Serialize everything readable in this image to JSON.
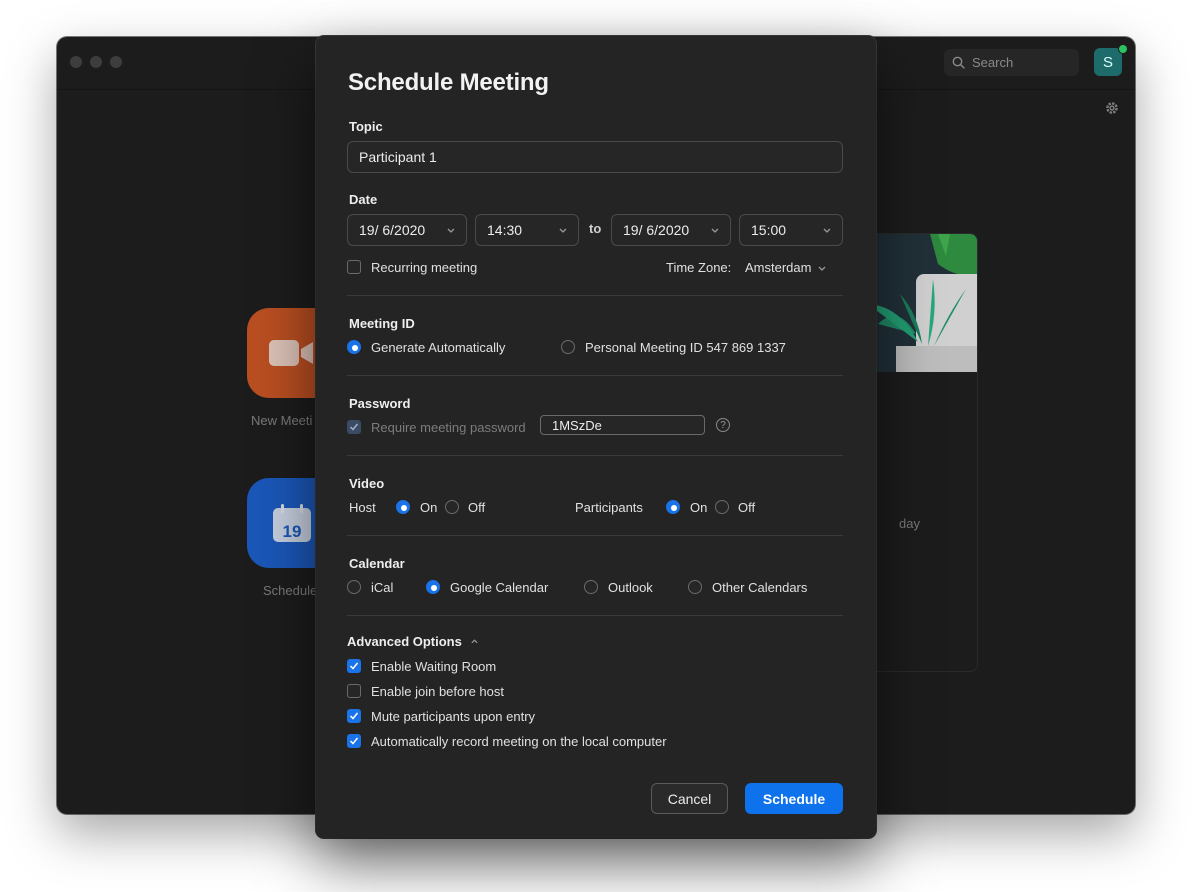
{
  "background": {
    "search_placeholder": "Search",
    "avatar_initial": "S",
    "tile_new_meeting_label": "New Meeti",
    "tile_schedule_label": "Schedule",
    "calendar_tile_day": "19",
    "card_text_fragment": "day"
  },
  "dialog": {
    "title": "Schedule Meeting",
    "topic": {
      "label": "Topic",
      "value": "Participant 1"
    },
    "date": {
      "label": "Date",
      "start_date": "19/ 6/2020",
      "start_time": "14:30",
      "to_label": "to",
      "end_date": "19/ 6/2020",
      "end_time": "15:00",
      "recurring_label": "Recurring meeting",
      "recurring_checked": false,
      "timezone_label": "Time Zone:",
      "timezone_value": "Amsterdam"
    },
    "meeting_id": {
      "label": "Meeting ID",
      "auto_label": "Generate Automatically",
      "personal_label": "Personal Meeting ID 547 869 1337",
      "selected": "auto"
    },
    "password": {
      "label": "Password",
      "require_label": "Require meeting password",
      "require_checked": true,
      "value": "1MSzDe",
      "help_icon": "?"
    },
    "video": {
      "label": "Video",
      "host_label": "Host",
      "participants_label": "Participants",
      "on_label": "On",
      "off_label": "Off",
      "host": "on",
      "participants": "on"
    },
    "calendar": {
      "label": "Calendar",
      "options": [
        "iCal",
        "Google Calendar",
        "Outlook",
        "Other Calendars"
      ],
      "selected": "Google Calendar"
    },
    "advanced": {
      "label": "Advanced Options",
      "options": [
        {
          "label": "Enable Waiting Room",
          "checked": true
        },
        {
          "label": "Enable join before host",
          "checked": false
        },
        {
          "label": "Mute participants upon entry",
          "checked": true
        },
        {
          "label": "Automatically record meeting on the local computer",
          "checked": true
        }
      ]
    },
    "buttons": {
      "cancel": "Cancel",
      "schedule": "Schedule"
    }
  },
  "colors": {
    "accent": "#1a73e8",
    "primary_button": "#0e72ed",
    "dialog_bg": "#242424",
    "window_bg": "#1c1c1c",
    "tile_orange": "#b94e21",
    "tile_blue": "#1a57b8"
  }
}
